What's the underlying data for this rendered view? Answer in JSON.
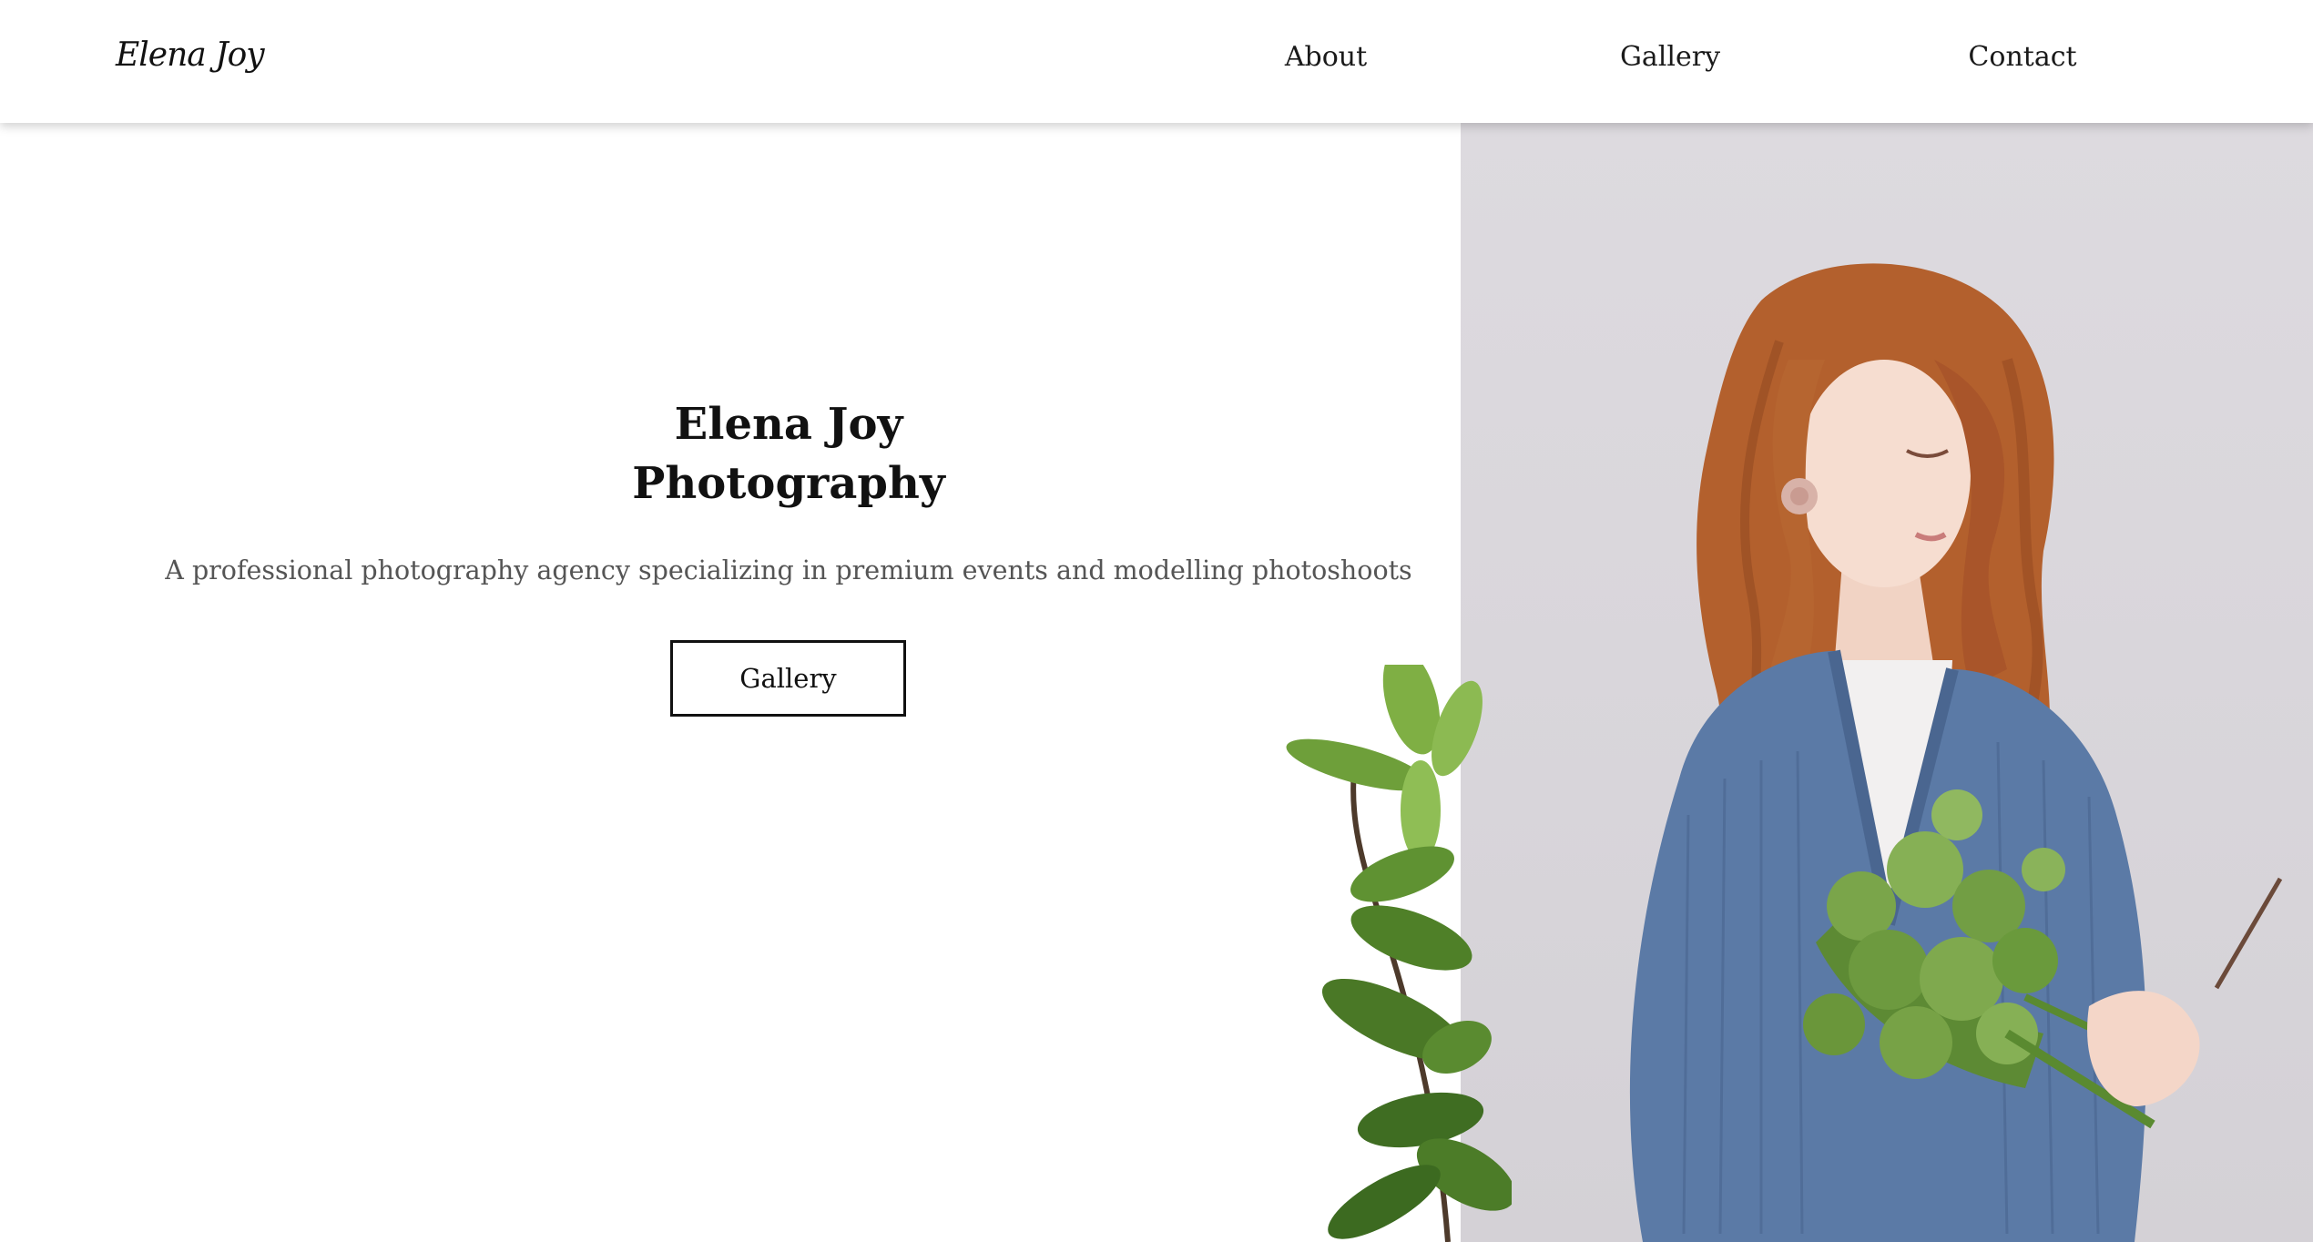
{
  "header": {
    "logo_text": "Elena Joy",
    "nav": {
      "about": "About",
      "gallery": "Gallery",
      "contact": "Contact"
    }
  },
  "hero": {
    "title_line1": "Elena Joy",
    "title_line2": "Photography",
    "subtitle": "A professional photography agency specializing in premium events and modelling photoshoots",
    "button_label": "Gallery"
  },
  "colors": {
    "text": "#111111",
    "subtitle": "#555555",
    "photo_background": "#dcd9de",
    "hair": "#b5602e",
    "cardigan": "#5b7aa6",
    "leaves": "#6a9a3c"
  },
  "icons": {
    "logo": "script-wordmark",
    "photo": "woman-with-bouquet"
  }
}
